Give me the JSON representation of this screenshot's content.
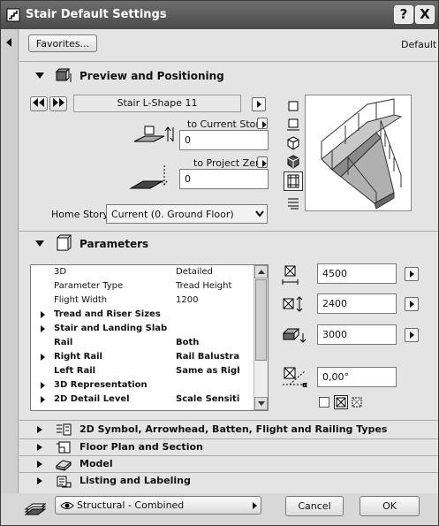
{
  "window": {
    "title": "Stair Default Settings",
    "help_label": "?",
    "close_label": "X"
  },
  "top": {
    "favorites_label": "Favorites...",
    "default_label": "Default"
  },
  "preview": {
    "section_title": "Preview and Positioning",
    "stair_name": "Stair L-Shape 11",
    "to_current_story_label": "to Current Story",
    "current_story_value": "0",
    "to_project_zero_label": "to Project Zero",
    "project_zero_value": "0",
    "home_story_label": "Home Story:",
    "home_story_value": "Current (0. Ground Floor)"
  },
  "parameters": {
    "section_title": "Parameters",
    "rows": [
      {
        "name": "3D",
        "value": "Detailed",
        "bold": false,
        "expandable": false
      },
      {
        "name": "Parameter Type",
        "value": "Tread Height",
        "bold": false,
        "expandable": false
      },
      {
        "name": "Flight Width",
        "value": "1200",
        "bold": false,
        "expandable": false
      },
      {
        "name": "Tread and Riser Sizes",
        "value": "",
        "bold": true,
        "expandable": true
      },
      {
        "name": "Stair and Landing Slab",
        "value": "",
        "bold": true,
        "expandable": true
      },
      {
        "name": "Rail",
        "value": "Both",
        "bold": true,
        "expandable": false
      },
      {
        "name": "Right Rail",
        "value": "Rail Balustrac",
        "bold": true,
        "expandable": true
      },
      {
        "name": "Left Rail",
        "value": "Same as Righ",
        "bold": true,
        "expandable": false
      },
      {
        "name": "3D Representation",
        "value": "",
        "bold": true,
        "expandable": true
      },
      {
        "name": "2D Detail Level",
        "value": "Scale Sensiti",
        "bold": true,
        "expandable": true
      }
    ],
    "width_value": "4500",
    "height_value": "2400",
    "elevation_value": "3000",
    "angle_value": "0,00°"
  },
  "sections": [
    {
      "label": "2D Symbol, Arrowhead, Batten, Flight and Railing Types",
      "icon": "symbol-icon"
    },
    {
      "label": "Floor Plan and Section",
      "icon": "floor-plan-icon"
    },
    {
      "label": "Model",
      "icon": "model-icon"
    },
    {
      "label": "Listing and Labeling",
      "icon": "listing-icon"
    }
  ],
  "footer": {
    "layer_value": "Structural - Combined",
    "cancel_label": "Cancel",
    "ok_label": "OK"
  }
}
